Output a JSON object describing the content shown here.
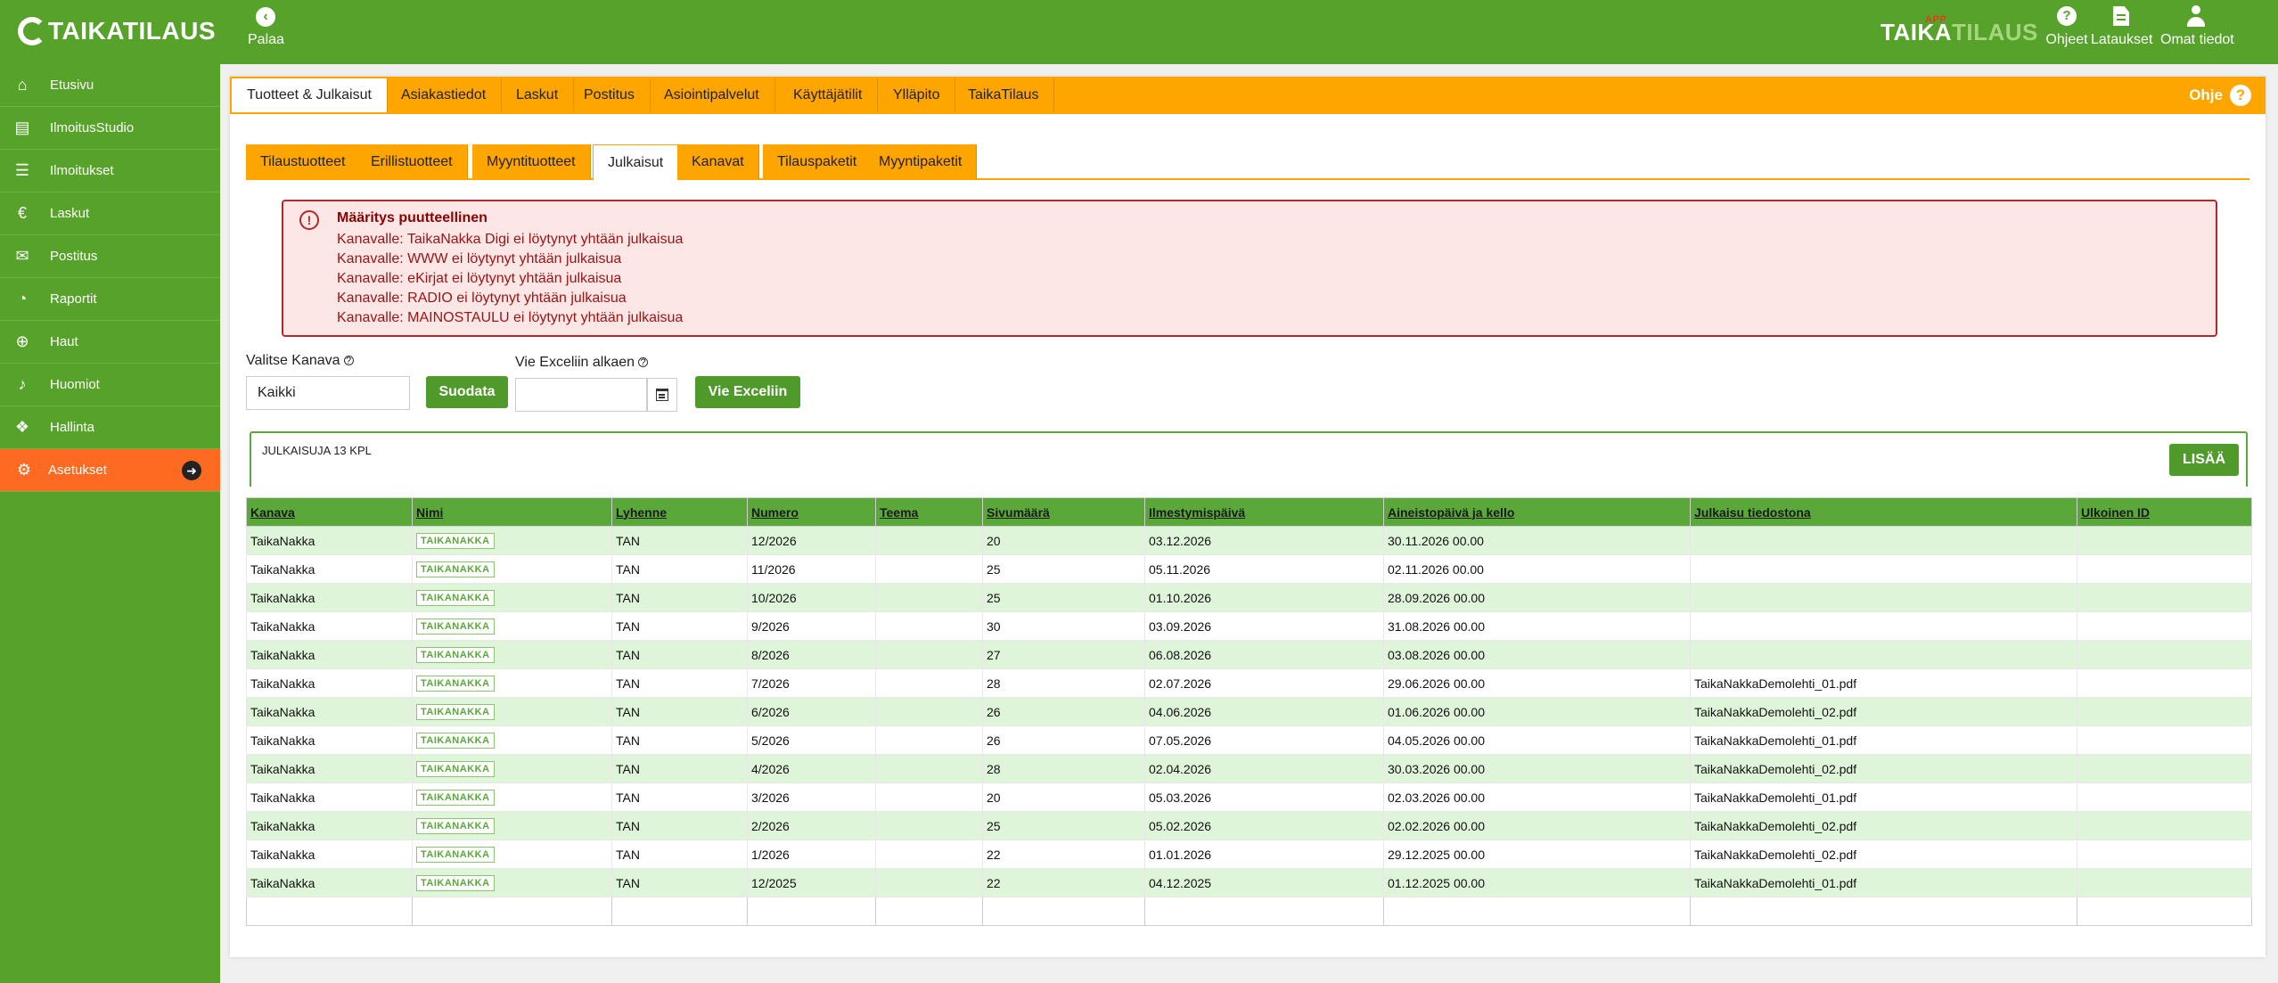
{
  "app": {
    "logo": "TAIKATILAUS"
  },
  "topbar": {
    "back_label": "Palaa",
    "brand_main": "TAIKA",
    "brand_sub": "TILAUS",
    "brand_hat": "APP",
    "help_label": "Ohjeet",
    "downloads_label": "Lataukset",
    "profile_label": "Omat tiedot"
  },
  "sidebar": {
    "items": [
      {
        "label": "Etusivu",
        "icon": "home-icon"
      },
      {
        "label": "IlmoitusStudio",
        "icon": "newspaper-icon"
      },
      {
        "label": "Ilmoitukset",
        "icon": "list-icon"
      },
      {
        "label": "Laskut",
        "icon": "euro-icon"
      },
      {
        "label": "Postitus",
        "icon": "envelope-icon"
      },
      {
        "label": "Raportit",
        "icon": "pie-chart-icon"
      },
      {
        "label": "Haut",
        "icon": "search-plus-icon"
      },
      {
        "label": "Huomiot",
        "icon": "bell-icon"
      },
      {
        "label": "Hallinta",
        "icon": "cubes-icon"
      },
      {
        "label": "Asetukset",
        "icon": "gear-icon",
        "active": true
      }
    ]
  },
  "tabs_main": [
    "Tuotteet & Julkaisut",
    "Asiakastiedot",
    "Laskut",
    "Postitus",
    "Asiointipalvelut",
    "Käyttäjätilit",
    "Ylläpito",
    "TaikaTilaus"
  ],
  "help_label": "Ohje",
  "tabs_sub": [
    "Tilaustuotteet",
    "Erillistuotteet",
    "Myyntituotteet",
    "Julkaisut",
    "Kanavat",
    "Tilauspaketit",
    "Myyntipaketit"
  ],
  "alert": {
    "title": "Määritys puutteellinen",
    "lines": [
      "Kanavalle: TaikaNakka Digi ei löytynyt yhtään julkaisua",
      "Kanavalle: WWW ei löytynyt yhtään julkaisua",
      "Kanavalle: eKirjat ei löytynyt yhtään julkaisua",
      "Kanavalle: RADIO ei löytynyt yhtään julkaisua",
      "Kanavalle: MAINOSTAULU ei löytynyt yhtään julkaisua"
    ]
  },
  "filters": {
    "channel_label": "Valitse Kanava",
    "channel_value": "Kaikki",
    "filter_button": "Suodata",
    "excel_label": "Vie Exceliin alkaen",
    "excel_date": "",
    "excel_button": "Vie Exceliin"
  },
  "list": {
    "count_text": "JULKAISUJA 13 KPL",
    "add_button": "LISÄÄ",
    "columns": [
      "Kanava",
      "Nimi",
      "Lyhenne",
      "Numero",
      "Teema",
      "Sivumäärä",
      "Ilmestymispäivä",
      "Aineistopäivä ja kello",
      "Julkaisu tiedostona",
      "Ulkoinen ID"
    ],
    "rows": [
      [
        "TaikaNakka",
        "TAIKANAKKA",
        "TAN",
        "12/2026",
        "",
        "20",
        "03.12.2026",
        "30.11.2026 00.00",
        "",
        ""
      ],
      [
        "TaikaNakka",
        "TAIKANAKKA",
        "TAN",
        "11/2026",
        "",
        "25",
        "05.11.2026",
        "02.11.2026 00.00",
        "",
        ""
      ],
      [
        "TaikaNakka",
        "TAIKANAKKA",
        "TAN",
        "10/2026",
        "",
        "25",
        "01.10.2026",
        "28.09.2026 00.00",
        "",
        ""
      ],
      [
        "TaikaNakka",
        "TAIKANAKKA",
        "TAN",
        "9/2026",
        "",
        "30",
        "03.09.2026",
        "31.08.2026 00.00",
        "",
        ""
      ],
      [
        "TaikaNakka",
        "TAIKANAKKA",
        "TAN",
        "8/2026",
        "",
        "27",
        "06.08.2026",
        "03.08.2026 00.00",
        "",
        ""
      ],
      [
        "TaikaNakka",
        "TAIKANAKKA",
        "TAN",
        "7/2026",
        "",
        "28",
        "02.07.2026",
        "29.06.2026 00.00",
        "TaikaNakkaDemolehti_01.pdf",
        ""
      ],
      [
        "TaikaNakka",
        "TAIKANAKKA",
        "TAN",
        "6/2026",
        "",
        "26",
        "04.06.2026",
        "01.06.2026 00.00",
        "TaikaNakkaDemolehti_02.pdf",
        ""
      ],
      [
        "TaikaNakka",
        "TAIKANAKKA",
        "TAN",
        "5/2026",
        "",
        "26",
        "07.05.2026",
        "04.05.2026 00.00",
        "TaikaNakkaDemolehti_01.pdf",
        ""
      ],
      [
        "TaikaNakka",
        "TAIKANAKKA",
        "TAN",
        "4/2026",
        "",
        "28",
        "02.04.2026",
        "30.03.2026 00.00",
        "TaikaNakkaDemolehti_02.pdf",
        ""
      ],
      [
        "TaikaNakka",
        "TAIKANAKKA",
        "TAN",
        "3/2026",
        "",
        "20",
        "05.03.2026",
        "02.03.2026 00.00",
        "TaikaNakkaDemolehti_01.pdf",
        ""
      ],
      [
        "TaikaNakka",
        "TAIKANAKKA",
        "TAN",
        "2/2026",
        "",
        "25",
        "05.02.2026",
        "02.02.2026 00.00",
        "TaikaNakkaDemolehti_02.pdf",
        ""
      ],
      [
        "TaikaNakka",
        "TAIKANAKKA",
        "TAN",
        "1/2026",
        "",
        "22",
        "01.01.2026",
        "29.12.2025 00.00",
        "TaikaNakkaDemolehti_02.pdf",
        ""
      ],
      [
        "TaikaNakka",
        "TAIKANAKKA",
        "TAN",
        "12/2025",
        "",
        "22",
        "04.12.2025",
        "01.12.2025 00.00",
        "TaikaNakkaDemolehti_01.pdf",
        ""
      ]
    ]
  },
  "colors": {
    "green": "#56a22a",
    "orange": "#ffa500",
    "active": "#ff6a22",
    "alert": "#b02a2a"
  }
}
